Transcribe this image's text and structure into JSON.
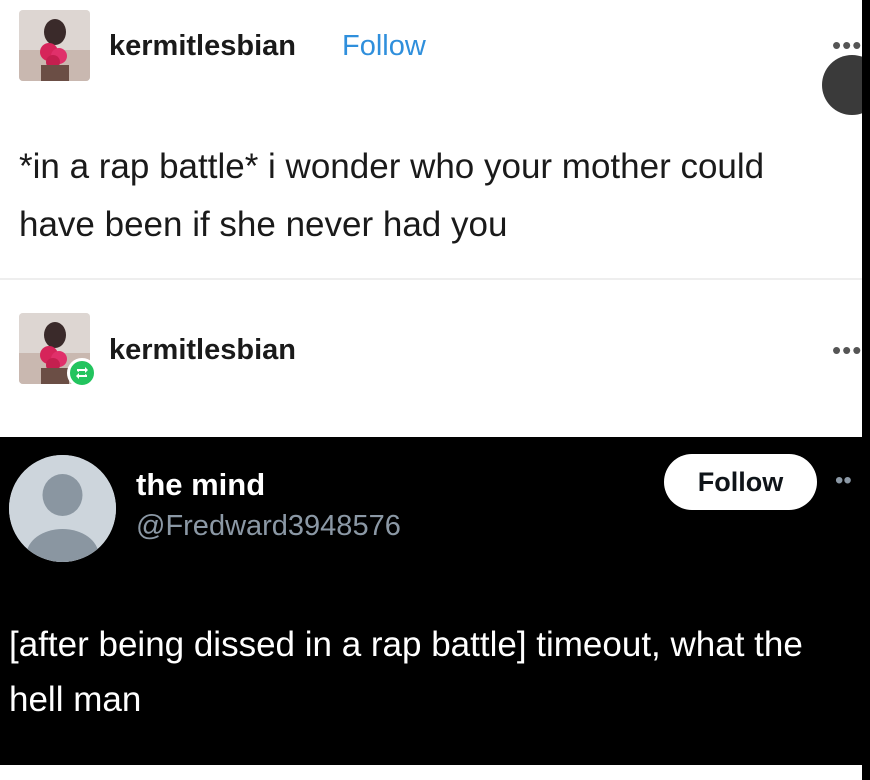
{
  "post": {
    "username": "kermitlesbian",
    "follow_label": "Follow",
    "text": "*in a rap battle* i wonder who your mother could have been if she never had you",
    "more_label": "•••"
  },
  "reblog": {
    "username": "kermitlesbian",
    "more_label": "•••"
  },
  "tweet": {
    "display_name": "the mind",
    "handle": "@Fredward3948576",
    "follow_label": "Follow",
    "more_label": "••",
    "text": "[after being dissed in a rap battle] timeout, what the hell man"
  },
  "colors": {
    "follow_link": "#2f8fdc",
    "reblog_badge": "#22c45e",
    "tweet_bg": "#000000",
    "handle_gray": "#8b98a5"
  }
}
